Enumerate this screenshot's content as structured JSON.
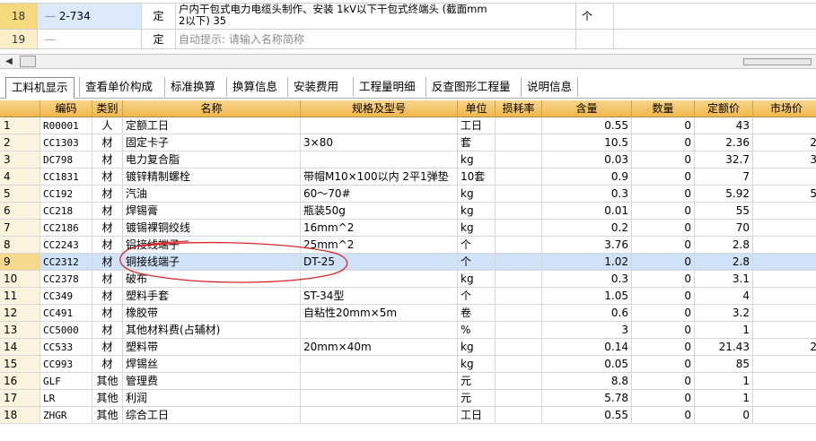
{
  "top_grid": {
    "rows": [
      {
        "row_no": "18",
        "code": "2-734",
        "type": "定",
        "name_line1": "户内干包式电力电缆头制作、安装 1kV以下干包式终端头 (截面mm",
        "name_line2": "2以下) 35",
        "unit": "个"
      },
      {
        "row_no": "19",
        "code": "",
        "type": "定",
        "name_line1": "自动提示: 请输入名称简称",
        "name_line2": "",
        "unit": ""
      }
    ]
  },
  "tabs": [
    "工料机显示",
    "查看单价构成",
    "标准换算",
    "换算信息",
    "安装费用",
    "工程量明细",
    "反查图形工程量",
    "说明信息"
  ],
  "active_tab": "工料机显示",
  "headers": [
    "编码",
    "类别",
    "名称",
    "规格及型号",
    "单位",
    "损耗率",
    "含量",
    "数量",
    "定额价",
    "市场价"
  ],
  "rows": [
    {
      "n": "1",
      "code": "R00001",
      "cat": "人",
      "name": "定额工日",
      "spec": "",
      "unit": "工日",
      "loss": "",
      "content": "0.55",
      "qty": "0",
      "price": "43",
      "market": ""
    },
    {
      "n": "2",
      "code": "CC1303",
      "cat": "材",
      "name": "固定卡子",
      "spec": "3×80",
      "unit": "套",
      "loss": "",
      "content": "10.5",
      "qty": "0",
      "price": "2.36",
      "market": "2"
    },
    {
      "n": "3",
      "code": "DC798",
      "cat": "材",
      "name": "电力复合脂",
      "spec": "",
      "unit": "kg",
      "loss": "",
      "content": "0.03",
      "qty": "0",
      "price": "32.7",
      "market": "3"
    },
    {
      "n": "4",
      "code": "CC1831",
      "cat": "材",
      "name": "镀锌精制螺栓",
      "spec": "带帽M10×100以内 2平1弹垫",
      "unit": "10套",
      "loss": "",
      "content": "0.9",
      "qty": "0",
      "price": "7",
      "market": ""
    },
    {
      "n": "5",
      "code": "CC192",
      "cat": "材",
      "name": "汽油",
      "spec": "60～70#",
      "unit": "kg",
      "loss": "",
      "content": "0.3",
      "qty": "0",
      "price": "5.92",
      "market": "5"
    },
    {
      "n": "6",
      "code": "CC218",
      "cat": "材",
      "name": "焊锡膏",
      "spec": "瓶装50g",
      "unit": "kg",
      "loss": "",
      "content": "0.01",
      "qty": "0",
      "price": "55",
      "market": ""
    },
    {
      "n": "7",
      "code": "CC2186",
      "cat": "材",
      "name": "镀锡裸铜绞线",
      "spec": "16mm^2",
      "unit": "kg",
      "loss": "",
      "content": "0.2",
      "qty": "0",
      "price": "70",
      "market": ""
    },
    {
      "n": "8",
      "code": "CC2243",
      "cat": "材",
      "name": "铝接线端子",
      "spec": "25mm^2",
      "unit": "个",
      "loss": "",
      "content": "3.76",
      "qty": "0",
      "price": "2.8",
      "market": ""
    },
    {
      "n": "9",
      "code": "CC2312",
      "cat": "材",
      "name": "铜接线端子",
      "spec": "DT-25",
      "unit": "个",
      "loss": "",
      "content": "1.02",
      "qty": "0",
      "price": "2.8",
      "market": ""
    },
    {
      "n": "10",
      "code": "CC2378",
      "cat": "材",
      "name": "破布",
      "spec": "",
      "unit": "kg",
      "loss": "",
      "content": "0.3",
      "qty": "0",
      "price": "3.1",
      "market": ""
    },
    {
      "n": "11",
      "code": "CC349",
      "cat": "材",
      "name": "塑料手套",
      "spec": "ST-34型",
      "unit": "个",
      "loss": "",
      "content": "1.05",
      "qty": "0",
      "price": "4",
      "market": ""
    },
    {
      "n": "12",
      "code": "CC491",
      "cat": "材",
      "name": "橡胶带",
      "spec": "自粘性20mm×5m",
      "unit": "卷",
      "loss": "",
      "content": "0.6",
      "qty": "0",
      "price": "3.2",
      "market": ""
    },
    {
      "n": "13",
      "code": "CC5000",
      "cat": "材",
      "name": "其他材料费(占辅材)",
      "spec": "",
      "unit": "%",
      "loss": "",
      "content": "3",
      "qty": "0",
      "price": "1",
      "market": ""
    },
    {
      "n": "14",
      "code": "CC533",
      "cat": "材",
      "name": "塑料带",
      "spec": "20mm×40m",
      "unit": "kg",
      "loss": "",
      "content": "0.14",
      "qty": "0",
      "price": "21.43",
      "market": "2"
    },
    {
      "n": "15",
      "code": "CC993",
      "cat": "材",
      "name": "焊锡丝",
      "spec": "",
      "unit": "kg",
      "loss": "",
      "content": "0.05",
      "qty": "0",
      "price": "85",
      "market": ""
    },
    {
      "n": "16",
      "code": "GLF",
      "cat": "其他",
      "name": "管理费",
      "spec": "",
      "unit": "元",
      "loss": "",
      "content": "8.8",
      "qty": "0",
      "price": "1",
      "market": ""
    },
    {
      "n": "17",
      "code": "LR",
      "cat": "其他",
      "name": "利润",
      "spec": "",
      "unit": "元",
      "loss": "",
      "content": "5.78",
      "qty": "0",
      "price": "1",
      "market": ""
    },
    {
      "n": "18",
      "code": "ZHGR",
      "cat": "其他",
      "name": "综合工日",
      "spec": "",
      "unit": "工日",
      "loss": "",
      "content": "0.55",
      "qty": "0",
      "price": "0",
      "market": ""
    }
  ],
  "selected_row": "9",
  "colors": {
    "header_bg": "#f0b84d",
    "row_number_bg": "#fbf3dd",
    "selected_row_bg": "#cfe2f7",
    "annotation": "#d9252a"
  }
}
